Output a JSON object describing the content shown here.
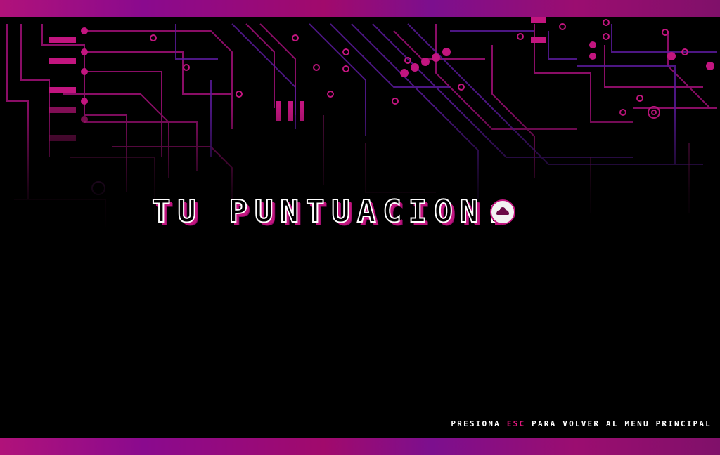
{
  "screen": {
    "title": "TU PUNTUACION:",
    "logo_icon": "racing-car-logo-icon"
  },
  "footer": {
    "hint_prefix": "PRESIONA",
    "hint_key": "ESC",
    "hint_suffix": "PARA VOLVER AL MENU PRINCIPAL"
  },
  "colors": {
    "background": "#000000",
    "accent_magenta": "#c2157f",
    "accent_purple": "#8a0a8e",
    "title_fill": "#000000",
    "title_outline": "#ffffff",
    "key_highlight": "#e0187c"
  }
}
